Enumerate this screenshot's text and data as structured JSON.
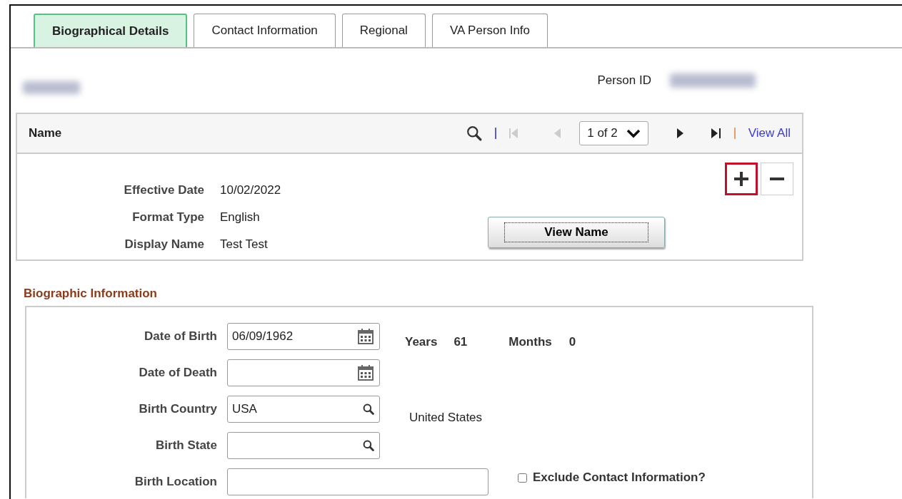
{
  "tabs": [
    {
      "label": "Biographical Details",
      "selected": true
    },
    {
      "label": "Contact Information",
      "selected": false
    },
    {
      "label": "Regional",
      "selected": false
    },
    {
      "label": "VA Person Info",
      "selected": false
    }
  ],
  "header": {
    "person_id_label": "Person ID"
  },
  "name_grid": {
    "title": "Name",
    "pager": "1 of 2",
    "view_all": "View All",
    "fields": [
      {
        "label": "Effective Date",
        "value": "10/02/2022"
      },
      {
        "label": "Format Type",
        "value": "English"
      },
      {
        "label": "Display Name",
        "value": "Test Test"
      }
    ],
    "add_highlighted": true,
    "view_button": "View Name"
  },
  "biographic": {
    "title": "Biographic Information",
    "fields": [
      {
        "label": "Date of Birth",
        "kind": "date",
        "value": "06/09/1962"
      },
      {
        "label": "Date of Death",
        "kind": "date"
      },
      {
        "label": "Birth Country",
        "kind": "lookup",
        "value": "USA",
        "description": "United States"
      },
      {
        "label": "Birth State",
        "kind": "lookup"
      },
      {
        "label": "Birth Location",
        "kind": "text"
      }
    ],
    "age": {
      "years_label": "Years",
      "years": "61",
      "months_label": "Months",
      "months": "0"
    },
    "exclude": {
      "label": "Exclude Contact Information?",
      "checked": false
    }
  }
}
